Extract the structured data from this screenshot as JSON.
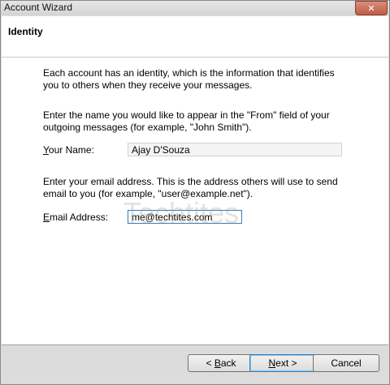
{
  "window": {
    "title": "Account Wizard",
    "close_glyph": "✕"
  },
  "page": {
    "title": "Identity"
  },
  "intro": {
    "line1": "Each account has an identity, which is the information that identifies",
    "line2": "you to others when they receive your messages."
  },
  "name_section": {
    "line1": "Enter the name you would like to appear in the \"From\" field of your",
    "line2": "outgoing messages (for example, \"John Smith\").",
    "label_accel": "Y",
    "label_rest": "our Name:",
    "value": "Ajay D'Souza"
  },
  "email_section": {
    "line1": "Enter your email address. This is the address others will use to send",
    "line2": "email to you (for example, \"user@example.net\").",
    "label_accel": "E",
    "label_rest": "mail Address:",
    "value": "me@techtites.com"
  },
  "buttons": {
    "back_arrow": "< ",
    "back_accel": "B",
    "back_rest": "ack",
    "next_accel": "N",
    "next_rest": "ext >",
    "cancel": "Cancel"
  },
  "watermark": "Techtites"
}
